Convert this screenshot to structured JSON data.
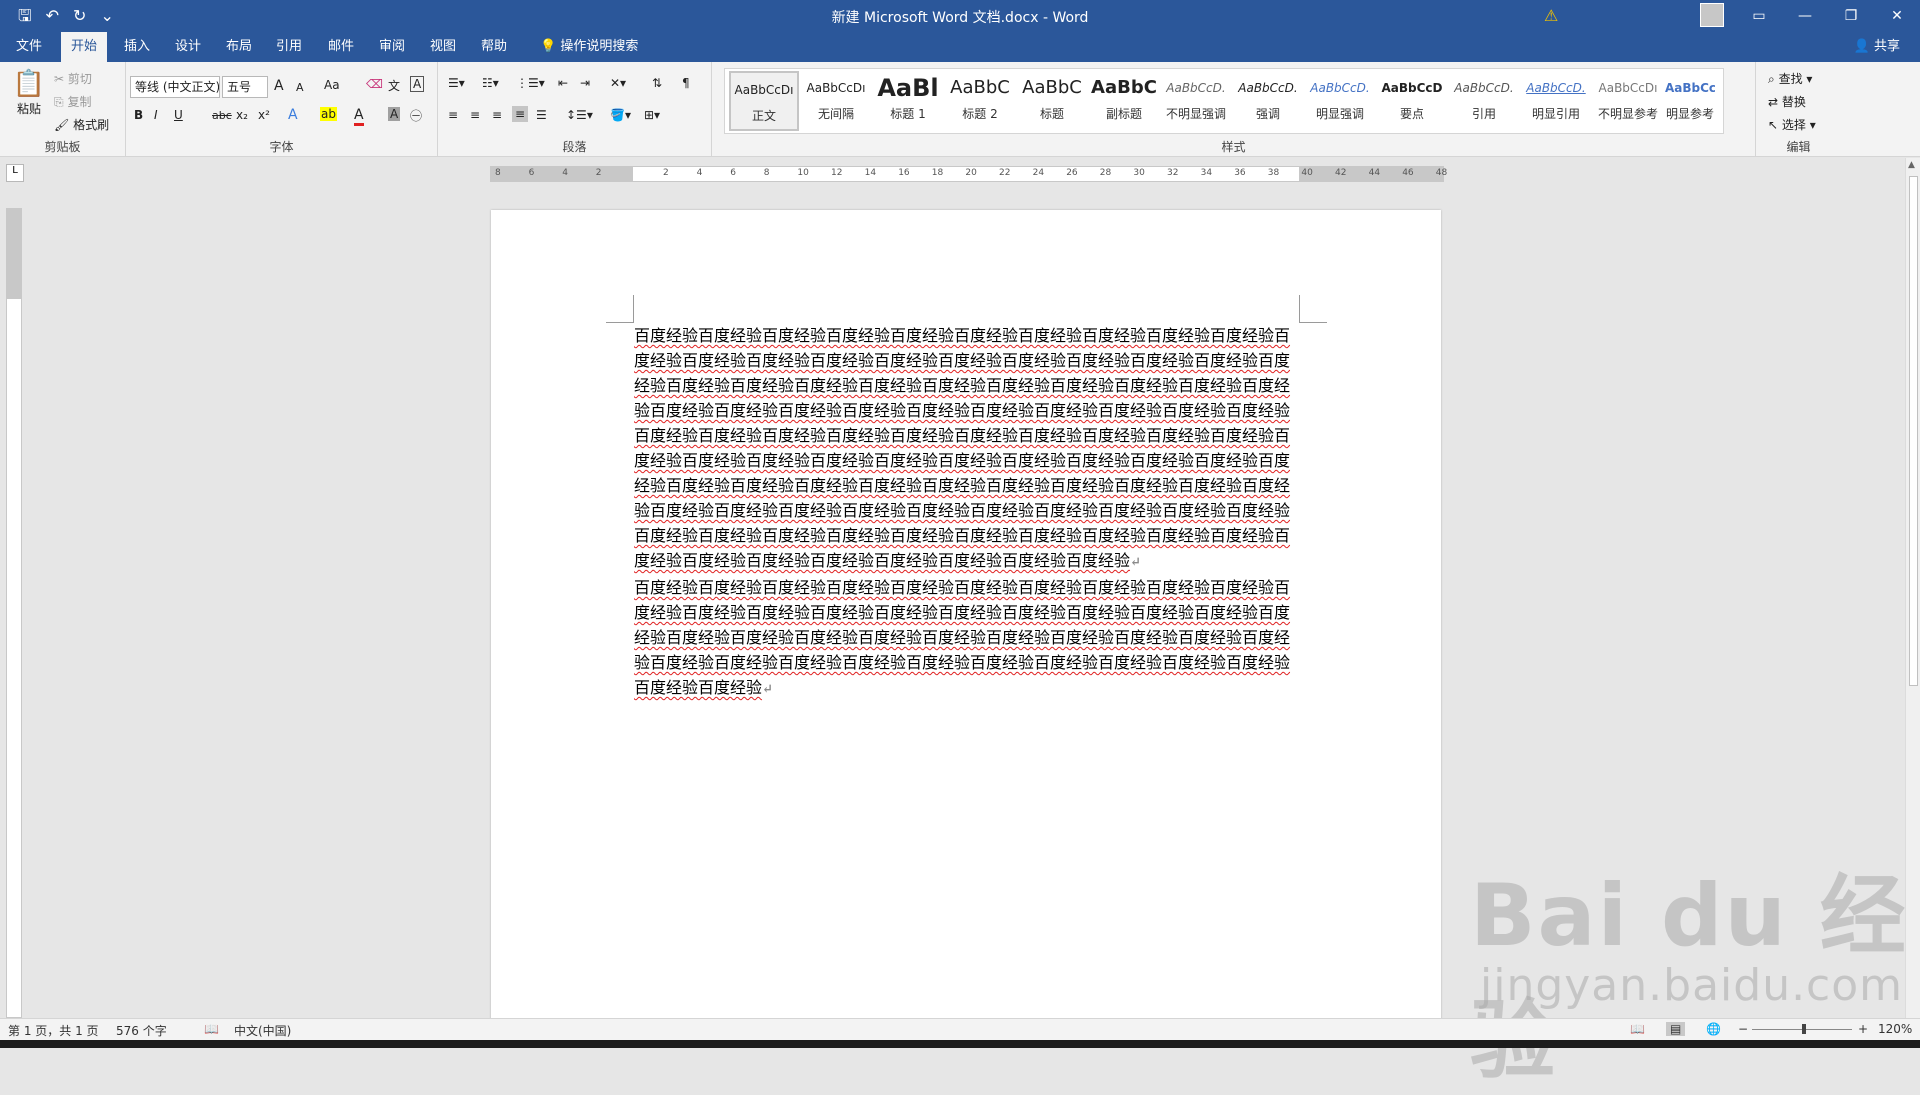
{
  "window": {
    "title": "新建 Microsoft Word 文档.docx  -  Word",
    "qat": {
      "save_icon": "🖫",
      "undo_icon": "↶",
      "redo_icon": "↻",
      "customize_icon": "⌄"
    },
    "warning_icon": "⚠",
    "controls": {
      "ribbon_display": "▭",
      "minimize": "—",
      "restore": "❐",
      "close": "✕"
    }
  },
  "tabs": [
    {
      "label": "文件"
    },
    {
      "label": "开始"
    },
    {
      "label": "插入"
    },
    {
      "label": "设计"
    },
    {
      "label": "布局"
    },
    {
      "label": "引用"
    },
    {
      "label": "邮件"
    },
    {
      "label": "审阅"
    },
    {
      "label": "视图"
    },
    {
      "label": "帮助"
    }
  ],
  "tell_me": "操作说明搜索",
  "share": "共享",
  "clipboard": {
    "paste": "粘贴",
    "cut": "剪切",
    "copy": "复制",
    "format_painter": "格式刷",
    "group_label": "剪贴板"
  },
  "font": {
    "font_name": "等线 (中文正文)",
    "font_size": "五号",
    "grow": "A",
    "shrink": "A",
    "change_case": "Aa",
    "bold": "B",
    "italic": "I",
    "underline": "U",
    "strike": "abc",
    "subscript": "x₂",
    "superscript": "x²",
    "text_effects": "A",
    "highlight": "ab",
    "font_color": "A",
    "char_shading": "A",
    "group_label": "字体"
  },
  "paragraph": {
    "group_label": "段落"
  },
  "styles": {
    "group_label": "样式",
    "items": [
      {
        "preview": "AaBbCcDı",
        "name": "正文"
      },
      {
        "preview": "AaBbCcDı",
        "name": "无间隔"
      },
      {
        "preview": "AaBl",
        "name": "标题 1"
      },
      {
        "preview": "AaBbC",
        "name": "标题 2"
      },
      {
        "preview": "AaBbC",
        "name": "标题"
      },
      {
        "preview": "AaBbC",
        "name": "副标题"
      },
      {
        "preview": "AaBbCcD.",
        "name": "不明显强调"
      },
      {
        "preview": "AaBbCcD.",
        "name": "强调"
      },
      {
        "preview": "AaBbCcD.",
        "name": "明显强调"
      },
      {
        "preview": "AaBbCcD",
        "name": "要点"
      },
      {
        "preview": "AaBbCcD.",
        "name": "引用"
      },
      {
        "preview": "AaBbCcD.",
        "name": "明显引用"
      },
      {
        "preview": "AaBbCcDı",
        "name": "不明显参考"
      },
      {
        "preview": "AaBbCcDı",
        "name": "明显参考"
      }
    ]
  },
  "editing": {
    "find": "查找",
    "replace": "替换",
    "select": "选择",
    "group_label": "编辑"
  },
  "ruler": {
    "ticks": [
      "8",
      "6",
      "4",
      "2",
      "",
      "2",
      "4",
      "6",
      "8",
      "10",
      "12",
      "14",
      "16",
      "18",
      "20",
      "22",
      "24",
      "26",
      "28",
      "30",
      "32",
      "34",
      "36",
      "38",
      "40",
      "42",
      "44",
      "46",
      "48"
    ]
  },
  "document": {
    "paragraphs": [
      "百度经验百度经验百度经验百度经验百度经验百度经验百度经验百度经验百度经验百度经验百度经验百度经验百度经验百度经验百度经验百度经验百度经验百度经验百度经验百度经验百度经验百度经验百度经验百度经验百度经验百度经验百度经验百度经验百度经验百度经验百度经验百度经验百度经验百度经验百度经验百度经验百度经验百度经验百度经验百度经验百度经验百度经验百度经验百度经验百度经验百度经验百度经验百度经验百度经验百度经验百度经验百度经验百度经验百度经验百度经验百度经验百度经验百度经验百度经验百度经验百度经验百度经验百度经验百度经验百度经验百度经验百度经验百度经验百度经验百度经验百度经验百度经验百度经验百度经验百度经验百度经验百度经验百度经验百度经验百度经验百度经验百度经验百度经验百度经验百度经验百度经验百度经验百度经验百度经验百度经验百度经验百度经验百度经验百度经验百度经验百度经验百度经验百度经验百度经验百度经验",
      "百度经验百度经验百度经验百度经验百度经验百度经验百度经验百度经验百度经验百度经验百度经验百度经验百度经验百度经验百度经验百度经验百度经验百度经验百度经验百度经验百度经验百度经验百度经验百度经验百度经验百度经验百度经验百度经验百度经验百度经验百度经验百度经验百度经验百度经验百度经验百度经验百度经验百度经验百度经验百度经验百度经验百度经验百度经验"
    ],
    "paragraph_mark": "↵"
  },
  "watermark": {
    "logo_text": "Bai du 经验",
    "url": "jingyan.baidu.com"
  },
  "status": {
    "page": "第 1 页，共 1 页",
    "words": "576 个字",
    "language": "中文(中国)",
    "zoom": "120%"
  }
}
